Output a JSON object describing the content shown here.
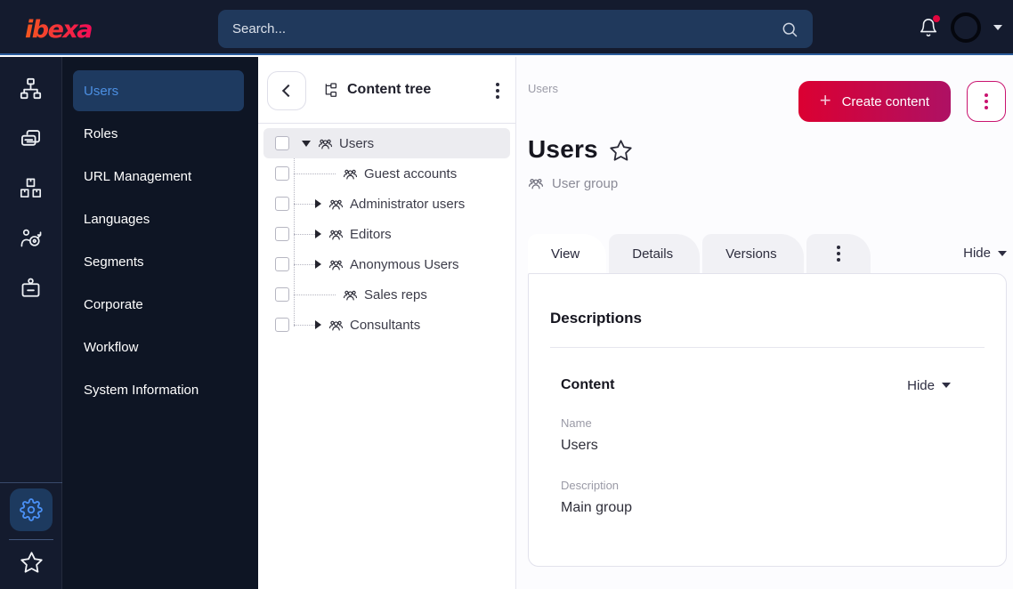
{
  "brand": {
    "logo_text": "ibexa"
  },
  "topbar": {
    "search_placeholder": "Search...",
    "icons": [
      "search-icon",
      "bell-icon",
      "avatar",
      "caret-down-icon"
    ],
    "notification_dot": true
  },
  "rail": {
    "icons": [
      "sitemap-icon",
      "pages-icon",
      "products-icon",
      "segments-target-icon",
      "id-badge-icon",
      "gear-icon",
      "star-icon"
    ],
    "active_icon": "gear-icon"
  },
  "sidebar": {
    "items": [
      {
        "label": "Users",
        "active": true
      },
      {
        "label": "Roles",
        "active": false
      },
      {
        "label": "URL Management",
        "active": false
      },
      {
        "label": "Languages",
        "active": false
      },
      {
        "label": "Segments",
        "active": false
      },
      {
        "label": "Corporate",
        "active": false
      },
      {
        "label": "Workflow",
        "active": false
      },
      {
        "label": "System Information",
        "active": false
      }
    ]
  },
  "content_tree": {
    "title": "Content tree",
    "items": [
      {
        "label": "Users",
        "state": "expanded",
        "selected": true,
        "level": 0
      },
      {
        "label": "Guest accounts",
        "state": "leaf",
        "selected": false,
        "level": 1
      },
      {
        "label": "Administrator users",
        "state": "collapsed",
        "selected": false,
        "level": 1
      },
      {
        "label": "Editors",
        "state": "collapsed",
        "selected": false,
        "level": 1
      },
      {
        "label": "Anonymous Users",
        "state": "collapsed",
        "selected": false,
        "level": 1
      },
      {
        "label": "Sales reps",
        "state": "leaf",
        "selected": false,
        "level": 1
      },
      {
        "label": "Consultants",
        "state": "collapsed",
        "selected": false,
        "level": 1
      }
    ]
  },
  "main": {
    "breadcrumb": "Users",
    "create_button_label": "Create content",
    "page_title": "Users",
    "content_type_label": "User group",
    "tabs": [
      {
        "label": "View",
        "active": true
      },
      {
        "label": "Details",
        "active": false
      },
      {
        "label": "Versions",
        "active": false
      }
    ],
    "hide_toggle": "Hide",
    "card": {
      "title": "Descriptions",
      "section": {
        "title": "Content",
        "hide_toggle": "Hide",
        "fields": [
          {
            "label": "Name",
            "value": "Users"
          },
          {
            "label": "Description",
            "value": "Main group"
          }
        ]
      }
    }
  },
  "colors": {
    "topbar_bg": "#141b2e",
    "sidebar_bg": "#0e1524",
    "search_bg": "#20395c",
    "active_item_bg": "#1e3a60",
    "active_link_blue": "#4c8fe2",
    "accent_gradient_start": "#db0032",
    "accent_gradient_end": "#ae1164",
    "accent_pink": "#c9136f",
    "topbar_divider_blue": "#2b5c9c",
    "tree_selected_bg": "#ececf0"
  }
}
